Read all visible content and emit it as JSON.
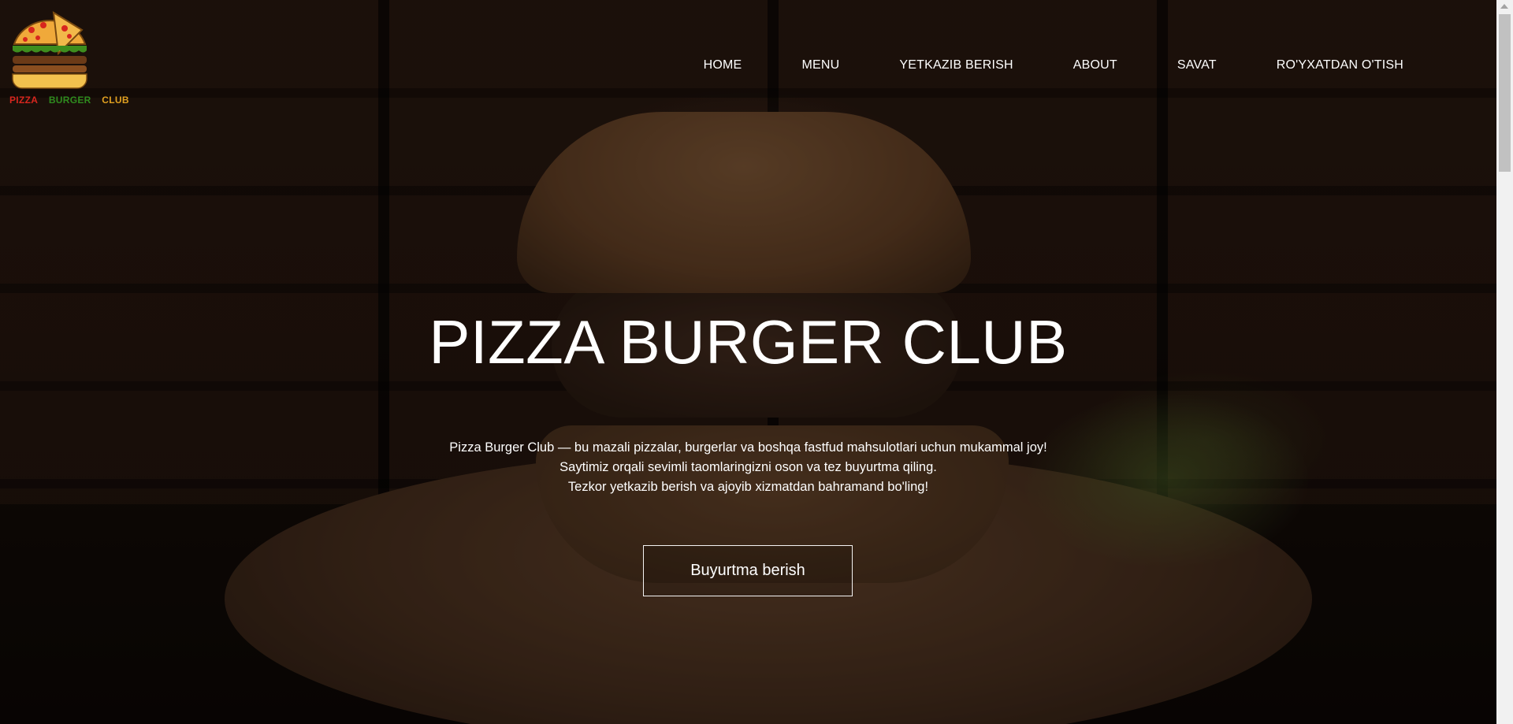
{
  "brand": {
    "logo_words": [
      "PIZZA",
      "BURGER",
      "CLUB"
    ],
    "logo_colors": [
      "#d7261e",
      "#2e8b1e",
      "#e0a020"
    ]
  },
  "nav": {
    "items": [
      {
        "label": "HOME"
      },
      {
        "label": "MENU"
      },
      {
        "label": "YETKAZIB BERISH"
      },
      {
        "label": "ABOUT"
      },
      {
        "label": "SAVAT"
      },
      {
        "label": "RO'YXATDAN O'TISH"
      }
    ]
  },
  "hero": {
    "title": "PIZZA BURGER CLUB",
    "description": [
      "Pizza Burger Club — bu mazali pizzalar, burgerlar va boshqa fastfud mahsulotlari uchun mukammal joy!",
      "Saytimiz orqali sevimli taomlaringizni oson va tez buyurtma qiling.",
      "Tezkor yetkazib berish va ajoyib xizmatdan bahramand bo'ling!"
    ],
    "cta_label": "Buyurtma berish"
  },
  "colors": {
    "text": "#ffffff",
    "overlay": "rgba(0,0,0,0.38)"
  },
  "icons": [
    "pizza-burger-logo-icon",
    "scroll-up-arrow-icon"
  ]
}
